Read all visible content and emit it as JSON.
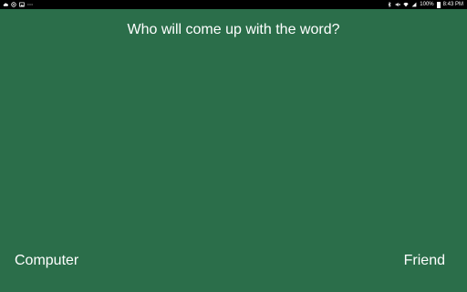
{
  "status_bar": {
    "left_icons": [
      "cloud-icon",
      "circle-icon",
      "image-icon",
      "more-icon"
    ],
    "right_icons": [
      "bluetooth-icon",
      "mute-icon",
      "wifi-icon",
      "signal-icon",
      "battery-icon"
    ],
    "battery_text": "100%",
    "time": "8:43 PM"
  },
  "question": "Who will come up with the word?",
  "options": {
    "left": "Computer",
    "right": "Friend"
  },
  "colors": {
    "background": "#2b6e4a",
    "status_bar": "#000000",
    "text": "#ffffff"
  }
}
